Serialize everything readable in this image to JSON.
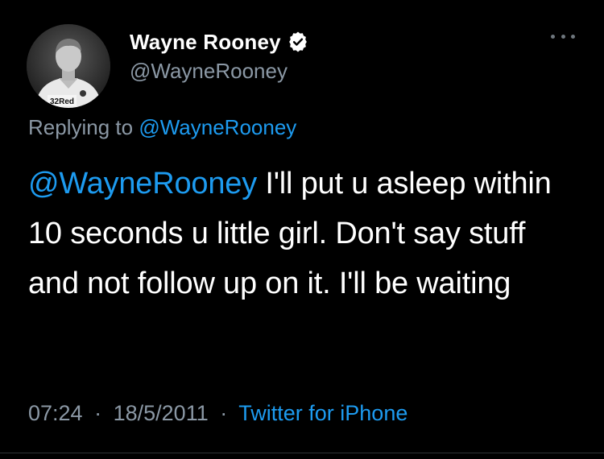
{
  "tweet": {
    "author": {
      "display_name": "Wayne Rooney",
      "handle": "@WayneRooney",
      "verified": true,
      "avatar_icon": "profile-photo",
      "avatar_shirt_text": "32Red"
    },
    "more_icon": "ellipsis-icon",
    "replying": {
      "prefix": "Replying to",
      "target": "@WayneRooney"
    },
    "body": {
      "mention": "@WayneRooney",
      "text": " I'll put u asleep within 10 seconds u little girl. Don't say stuff and not follow up on it. I'll be waiting"
    },
    "meta": {
      "time": "07:24",
      "separator": "·",
      "date": "18/5/2011",
      "source": "Twitter for iPhone"
    }
  },
  "colors": {
    "background": "#000000",
    "text": "#ffffff",
    "secondary": "#8b98a5",
    "link": "#1d9bf0"
  }
}
